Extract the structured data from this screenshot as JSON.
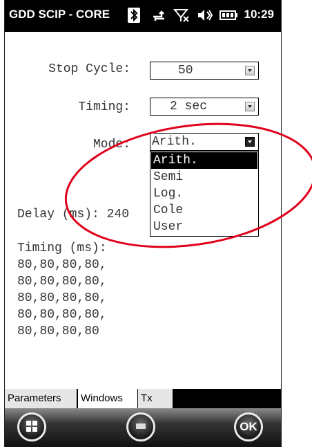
{
  "status_bar": {
    "title": "GDD SCIP - CORE",
    "time": "10:29",
    "icons": [
      "bluetooth-icon",
      "data-connection-icon",
      "no-signal-icon",
      "speaker-icon",
      "battery-icon"
    ]
  },
  "form": {
    "stop_cycle": {
      "label": "Stop Cycle:",
      "value": "50"
    },
    "timing": {
      "label": "Timing:",
      "value": "2 sec"
    },
    "mode": {
      "label": "Mode:",
      "value": "Arith.",
      "options": [
        "Arith.",
        "Semi",
        "Log.",
        "Cole",
        "User"
      ],
      "selected_index": 0
    },
    "delay": {
      "text": "Delay (ms): 240"
    },
    "timing_ms": {
      "heading": "Timing (ms):",
      "lines": [
        "80,80,80,80,",
        "80,80,80,80,",
        "80,80,80,80,",
        "80,80,80,80,",
        "80,80,80,80"
      ]
    }
  },
  "tabs": [
    {
      "label": "Parameters",
      "active": false
    },
    {
      "label": "Windows",
      "active": true
    },
    {
      "label": "Tx",
      "active": false
    }
  ],
  "softkeys": {
    "ok_label": "OK",
    "left": "windows-start-icon",
    "center": "keyboard-icon"
  },
  "colors": {
    "annotation": "#e0001a",
    "selection": "#000000"
  }
}
